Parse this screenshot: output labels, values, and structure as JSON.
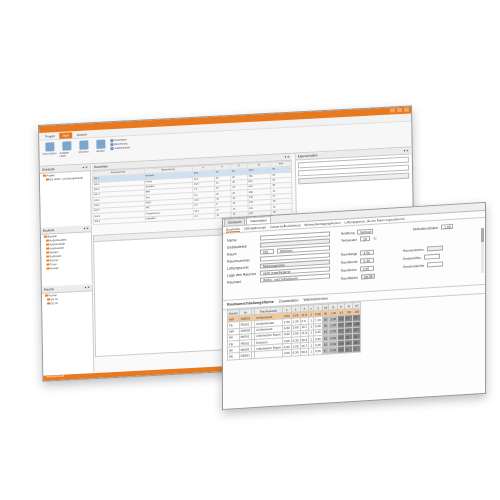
{
  "back": {
    "menu": [
      "Projekt",
      "Start",
      "Ansicht"
    ],
    "ribbon_buttons": [
      "Import Daten",
      "Ausgabe Listen",
      "Übersicht",
      "Struktur"
    ],
    "ribbon_small": [
      "Raumdaten",
      "Berechnung",
      "Außenbauteile"
    ],
    "panel_gebaeude": "Gebäude",
    "panel_bauteile": "Bauteile",
    "panel_raeume": "Räume",
    "panel_raumliste": "Raumliste",
    "panel_eigenschaften": "Eigenschaften",
    "tree": [
      "Projekt",
      "EG Wohn- und Bürogebäude"
    ],
    "bauteile_tree": [
      "Bauteile",
      "Außenbauteile",
      "Außenwände",
      "Innenwände",
      "Decken",
      "Fußböden",
      "Dächer",
      "Türen",
      "Fenster"
    ],
    "raeume_tree": [
      "Räume",
      "EG 01",
      "EG 02"
    ],
    "grid_headers": [
      "Raumnummer",
      "Bezeichnung",
      "A",
      "V",
      "θ",
      "Φ",
      "Φ/A"
    ],
    "grid_rows": [
      [
        "EG 1",
        "Wohnen",
        "28.4",
        "75",
        "20",
        "1574",
        "55"
      ],
      [
        "EG 2",
        "Küche",
        "12.1",
        "32",
        "20",
        "706",
        "58"
      ],
      [
        "EG 3",
        "Schlafen",
        "16.8",
        "44",
        "20",
        "844",
        "50"
      ],
      [
        "EG 4",
        "Bad",
        "7.2",
        "19",
        "24",
        "612",
        "85"
      ],
      [
        "EG 5",
        "Flur",
        "9.4",
        "25",
        "20",
        "298",
        "32"
      ],
      [
        "EG 6",
        "Kind",
        "13.0",
        "34",
        "20",
        "700",
        "54"
      ],
      [
        "EG 7",
        "WC",
        "2.9",
        "8",
        "20",
        "140",
        "48"
      ],
      [
        "EG 8",
        "Treppenhaus",
        "10.3",
        "27",
        "15",
        "415",
        "40"
      ],
      [
        "EG 9",
        "Abstellen",
        "4.1",
        "11",
        "15",
        "120",
        "29"
      ]
    ],
    "status": "www.dendrit.de"
  },
  "front": {
    "tabs": [
      "Startseite",
      "Raumdaten"
    ],
    "subtabs": [
      "Geometrie",
      "Lüftungskonzept",
      "Zusatz-Aufheizleistung",
      "Wärmeübertragung/Heizen",
      "Lüftungsgrenze, die der Raum zugeordnet ist"
    ],
    "form": {
      "name_label": "Name",
      "gebaeudeteil_label": "Gebäudeteil",
      "raum_label": "Raum",
      "raum_value": "001",
      "raum_name": "Wohnen",
      "raumnummer_label": "Raumnummer",
      "lueftungszone_label": "Lüftungszone",
      "lueftungszone_value": "Nutzungszone",
      "lage_label": "Lage des Raumes",
      "lage_value": "nicht innenliegend",
      "raumart_label": "Raumart",
      "raumart_value": "Wohn- und Schlafraum",
      "belueftung_label": "Belüftung",
      "belueftung_value": "beheizt",
      "temperatur_label": "Temperatur",
      "temperatur_value": "20",
      "modul_label": "Modulationsfaktor",
      "modul_value": "1.00",
      "raumlaenge_label": "Raumlänge",
      "raumlaenge_value": "4.50",
      "raumbreite_label": "Raumbreite",
      "raumbreite_value": "6.30",
      "raumhoehe_label": "Raumhöhe",
      "raumhoehe_value": "2.65",
      "raumflaeche_label": "Raumfläche",
      "raumflaeche_value": "28.35",
      "raumvolumen_label": "Raumvolumen",
      "deckenhoehe_label": "Deckenhöhe",
      "geschosshoehe_label": "Geschosshöhe"
    },
    "section_tabs": [
      "Raumumschließungsfläche",
      "Zusatzdaten",
      "Wärmebrücken"
    ],
    "table_headers": [
      "Bauteil",
      "Nr",
      "",
      "Raumbauteile",
      "b",
      "h",
      "A",
      "n",
      "U",
      "Δθ",
      "fk",
      "H",
      "Φ",
      "ΦT"
    ],
    "table_rows": [
      [
        "AW",
        "AW001",
        "",
        "Außenwand",
        "4.50",
        "2.65",
        "11.9",
        "1",
        "0.28",
        "30",
        "1.00",
        "3.3",
        "100",
        "100"
      ],
      [
        "FE",
        "FE001",
        "",
        "Außenfenster",
        "1.50",
        "1.35",
        "2.0",
        "1",
        "1.10",
        "30",
        "1.00",
        "2.2",
        "67",
        "67"
      ],
      [
        "AW",
        "AW002",
        "",
        "Außenwand",
        "6.30",
        "2.65",
        "16.7",
        "1",
        "0.28",
        "30",
        "1.00",
        "4.7",
        "140",
        "140"
      ],
      [
        "IW",
        "IW001",
        "",
        "unbeheizter Raum",
        "4.50",
        "2.65",
        "11.9",
        "1",
        "0.45",
        "10",
        "0.50",
        "2.7",
        "27",
        "27"
      ],
      [
        "FB",
        "FB001",
        "",
        "Erdreich",
        "4.50",
        "6.30",
        "28.4",
        "1",
        "0.30",
        "10",
        "0.60",
        "5.1",
        "51",
        "51"
      ],
      [
        "IW",
        "IW002",
        "",
        "unbeheizter Raum",
        "6.30",
        "2.65",
        "16.7",
        "1",
        "0.45",
        "10",
        "0.50",
        "3.8",
        "38",
        "38"
      ],
      [
        "DE",
        "DE001",
        "",
        "",
        "4.50",
        "6.30",
        "28.4",
        "1",
        "0.20",
        "0",
        "0.00",
        "0.0",
        "0",
        "0"
      ]
    ]
  }
}
